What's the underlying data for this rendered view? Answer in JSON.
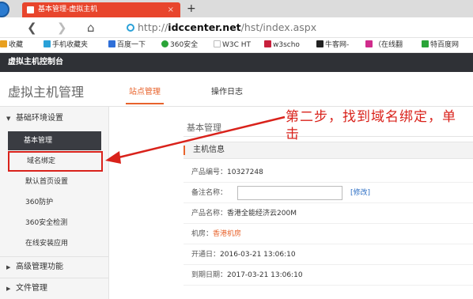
{
  "browser": {
    "tab_title": "基本管理-虚拟主机",
    "tab_close": "×",
    "new_tab": "+",
    "url_prefix": "http://",
    "url_host": "idccenter.net",
    "url_path": "/hst/index.aspx",
    "bookmarks": [
      {
        "label": "收藏",
        "icon_color": "#e8a020"
      },
      {
        "label": "手机收藏夹",
        "icon_color": "#2aa1d8"
      },
      {
        "label": "百度一下",
        "icon_color": "#2f6fd8"
      },
      {
        "label": "360安全",
        "icon_color": "#2aa438"
      },
      {
        "label": "W3C HT",
        "icon_color": "#bbbbbb"
      },
      {
        "label": "w3scho",
        "icon_color": "#c8203c"
      },
      {
        "label": "牛客网-",
        "icon_color": "#222222"
      },
      {
        "label": "（在线翻",
        "icon_color": "#d02c8c"
      },
      {
        "label": "特百度网",
        "icon_color": "#2aa438"
      }
    ]
  },
  "app": {
    "brand": "虚拟主机控制台",
    "page_title": "虚拟主机管理",
    "tabs": [
      {
        "label": "站点管理",
        "active": true
      },
      {
        "label": "操作日志",
        "active": false
      }
    ]
  },
  "sidebar": {
    "groups": [
      {
        "label": "基础环境设置",
        "expanded": true
      },
      {
        "label": "高级管理功能",
        "expanded": false
      },
      {
        "label": "文件管理",
        "expanded": false
      }
    ],
    "items": [
      {
        "label": "基本管理"
      },
      {
        "label": "域名绑定"
      },
      {
        "label": "默认首页设置"
      },
      {
        "label": "360防护"
      },
      {
        "label": "360安全检测"
      },
      {
        "label": "在线安装应用"
      }
    ]
  },
  "main": {
    "breadcrumb": "基本管理",
    "panel_title": "主机信息",
    "fields": [
      {
        "label": "产品编号：",
        "value": "10327248"
      },
      {
        "label": "备注名称：",
        "value": "",
        "action": "[修改]"
      },
      {
        "label": "产品名称：",
        "value": "香港全能经济云200M"
      },
      {
        "label": "机房：",
        "value": "香港机房"
      },
      {
        "label": "开通日：",
        "value": "2016-03-21 13:06:10"
      },
      {
        "label": "到期日期：",
        "value": "2017-03-21 13:06:10"
      }
    ]
  },
  "annotation": {
    "text": "第二步，找到域名绑定，单击",
    "color": "#d9221b"
  },
  "colors": {
    "accent": "#e8632c",
    "tab_red": "#e8452c",
    "header_dark": "#2f3136",
    "sidebar_selected": "#3a3c42",
    "link_blue": "#2c6ec4"
  }
}
